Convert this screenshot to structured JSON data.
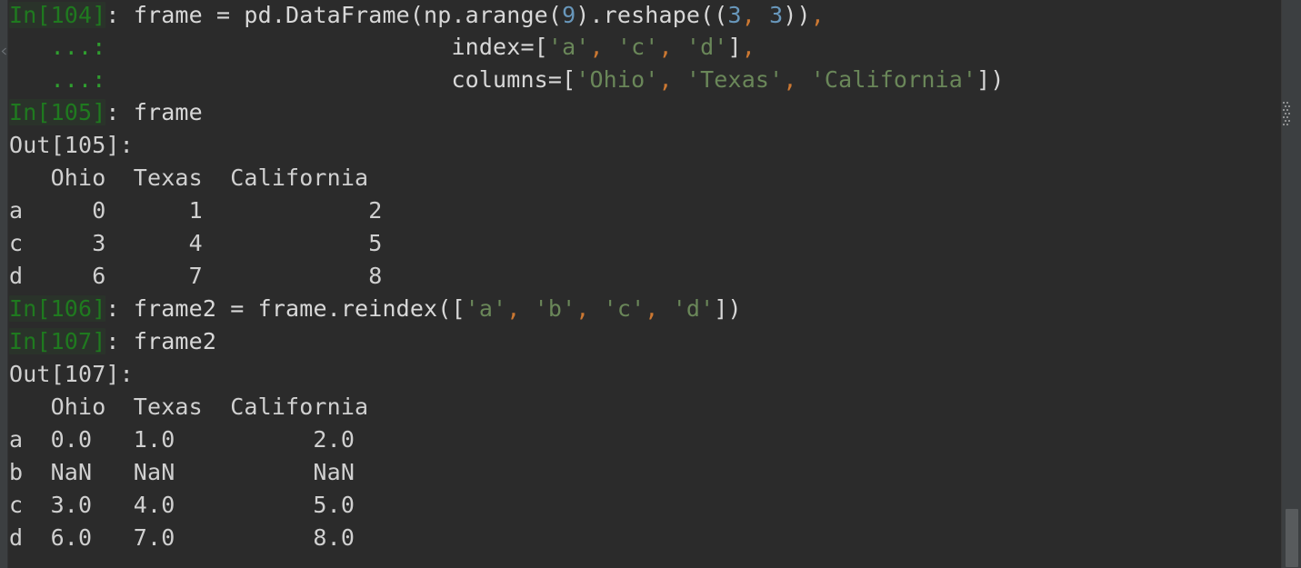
{
  "app": {
    "name": "ipython-console",
    "background": "#2b2b2b",
    "foreground": "#d8d8d8"
  },
  "colors": {
    "prompt_in": "#1f7a1f",
    "prompt_continuation": "#2f9e2f",
    "string": "#6a8759",
    "number": "#6897bb",
    "punctuation": "#cc7832",
    "plain_text": "#d8d8d8",
    "gutter": "#3c3f41",
    "scrollbar_thumb": "#585b5d"
  },
  "gutter": {
    "marker_name": "code-fold-marker"
  },
  "scrollbar": {
    "orientation": "vertical",
    "thumb_position": "bottom",
    "grip_name": "resize-grip"
  },
  "lines": [
    {
      "id": "l1",
      "segments": [
        {
          "cls": "tok-prompt-in band",
          "text": "In[104]"
        },
        {
          "cls": "tok-plain",
          "text": ": frame = pd.DataFrame"
        },
        {
          "cls": "tok-plain",
          "text": "(np.arange("
        },
        {
          "cls": "tok-num",
          "text": "9"
        },
        {
          "cls": "tok-plain",
          "text": ").reshape(("
        },
        {
          "cls": "tok-num",
          "text": "3"
        },
        {
          "cls": "tok-punct",
          "text": ","
        },
        {
          "cls": "tok-plain",
          "text": " "
        },
        {
          "cls": "tok-num",
          "text": "3"
        },
        {
          "cls": "tok-plain",
          "text": "))"
        },
        {
          "cls": "tok-punct",
          "text": ","
        }
      ]
    },
    {
      "id": "l2",
      "segments": [
        {
          "cls": "tok-prompt-cont",
          "text": "   ...:"
        },
        {
          "cls": "tok-plain",
          "text": "                         index=["
        },
        {
          "cls": "tok-str",
          "text": "'a'"
        },
        {
          "cls": "tok-punct",
          "text": ","
        },
        {
          "cls": "tok-str",
          "text": " 'c'"
        },
        {
          "cls": "tok-punct",
          "text": ","
        },
        {
          "cls": "tok-str",
          "text": " 'd'"
        },
        {
          "cls": "tok-plain",
          "text": "]"
        },
        {
          "cls": "tok-punct",
          "text": ","
        }
      ]
    },
    {
      "id": "l3",
      "segments": [
        {
          "cls": "tok-prompt-cont",
          "text": "   ...:"
        },
        {
          "cls": "tok-plain",
          "text": "                         columns=["
        },
        {
          "cls": "tok-str",
          "text": "'Ohio'"
        },
        {
          "cls": "tok-punct",
          "text": ","
        },
        {
          "cls": "tok-str",
          "text": " 'Texas'"
        },
        {
          "cls": "tok-punct",
          "text": ","
        },
        {
          "cls": "tok-str",
          "text": " 'California'"
        },
        {
          "cls": "tok-plain",
          "text": "])"
        }
      ]
    },
    {
      "id": "l4",
      "segments": [
        {
          "cls": "tok-prompt-in band",
          "text": "In[105]"
        },
        {
          "cls": "tok-plain",
          "text": ": frame"
        }
      ]
    },
    {
      "id": "l5",
      "segments": [
        {
          "cls": "tok-out",
          "text": "Out[105]:"
        }
      ]
    },
    {
      "id": "l6",
      "segments": [
        {
          "cls": "tok-out",
          "text": "   Ohio  Texas  California"
        }
      ]
    },
    {
      "id": "l7",
      "segments": [
        {
          "cls": "tok-out",
          "text": "a     0      1            2"
        }
      ]
    },
    {
      "id": "l8",
      "segments": [
        {
          "cls": "tok-out",
          "text": "c     3      4            5"
        }
      ]
    },
    {
      "id": "l9",
      "segments": [
        {
          "cls": "tok-out",
          "text": "d     6      7            8"
        }
      ]
    },
    {
      "id": "l10",
      "segments": [
        {
          "cls": "tok-prompt-in band",
          "text": "In[106]"
        },
        {
          "cls": "tok-plain",
          "text": ": frame2 = frame.reindex(["
        },
        {
          "cls": "tok-str",
          "text": "'a'"
        },
        {
          "cls": "tok-punct",
          "text": ","
        },
        {
          "cls": "tok-str",
          "text": " 'b'"
        },
        {
          "cls": "tok-punct",
          "text": ","
        },
        {
          "cls": "tok-str",
          "text": " 'c'"
        },
        {
          "cls": "tok-punct",
          "text": ","
        },
        {
          "cls": "tok-str",
          "text": " 'd'"
        },
        {
          "cls": "tok-plain",
          "text": "])"
        }
      ]
    },
    {
      "id": "l11",
      "segments": [
        {
          "cls": "tok-prompt-in band",
          "text": "In[107]"
        },
        {
          "cls": "tok-plain",
          "text": ": frame2"
        }
      ]
    },
    {
      "id": "l12",
      "segments": [
        {
          "cls": "tok-out",
          "text": "Out[107]:"
        }
      ]
    },
    {
      "id": "l13",
      "segments": [
        {
          "cls": "tok-out",
          "text": "   Ohio  Texas  California"
        }
      ]
    },
    {
      "id": "l14",
      "segments": [
        {
          "cls": "tok-out",
          "text": "a  0.0   1.0          2.0"
        }
      ]
    },
    {
      "id": "l15",
      "segments": [
        {
          "cls": "tok-out",
          "text": "b  NaN   NaN          NaN"
        }
      ]
    },
    {
      "id": "l16",
      "segments": [
        {
          "cls": "tok-out",
          "text": "c  3.0   4.0          5.0"
        }
      ]
    },
    {
      "id": "l17",
      "segments": [
        {
          "cls": "tok-out",
          "text": "d  6.0   7.0          8.0"
        }
      ]
    }
  ],
  "tables": [
    {
      "name": "frame-output",
      "out_label": "Out[105]:",
      "index_name": "",
      "columns": [
        "Ohio",
        "Texas",
        "California"
      ],
      "index": [
        "a",
        "c",
        "d"
      ],
      "rows": [
        [
          "0",
          "1",
          "2"
        ],
        [
          "3",
          "4",
          "5"
        ],
        [
          "6",
          "7",
          "8"
        ]
      ]
    },
    {
      "name": "frame2-output",
      "out_label": "Out[107]:",
      "index_name": "",
      "columns": [
        "Ohio",
        "Texas",
        "California"
      ],
      "index": [
        "a",
        "b",
        "c",
        "d"
      ],
      "rows": [
        [
          "0.0",
          "1.0",
          "2.0"
        ],
        [
          "NaN",
          "NaN",
          "NaN"
        ],
        [
          "3.0",
          "4.0",
          "5.0"
        ],
        [
          "6.0",
          "7.0",
          "8.0"
        ]
      ]
    }
  ]
}
